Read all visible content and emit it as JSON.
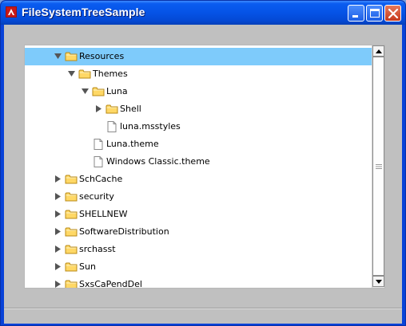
{
  "window": {
    "title": "FileSystemTreeSample"
  },
  "titlebar_buttons": {
    "minimize": "minimize-icon",
    "maximize": "maximize-icon",
    "close": "close-icon"
  },
  "tree": {
    "selected_index": 0,
    "items": [
      {
        "label": "Resources",
        "type": "folder",
        "depth": 0,
        "expander": "expanded"
      },
      {
        "label": "Themes",
        "type": "folder",
        "depth": 1,
        "expander": "expanded"
      },
      {
        "label": "Luna",
        "type": "folder",
        "depth": 2,
        "expander": "expanded"
      },
      {
        "label": "Shell",
        "type": "folder",
        "depth": 3,
        "expander": "collapsed"
      },
      {
        "label": "luna.msstyles",
        "type": "file",
        "depth": 3,
        "expander": "none"
      },
      {
        "label": "Luna.theme",
        "type": "file",
        "depth": 2,
        "expander": "none"
      },
      {
        "label": "Windows Classic.theme",
        "type": "file",
        "depth": 2,
        "expander": "none"
      },
      {
        "label": "SchCache",
        "type": "folder",
        "depth": 0,
        "expander": "collapsed"
      },
      {
        "label": "security",
        "type": "folder",
        "depth": 0,
        "expander": "collapsed"
      },
      {
        "label": "SHELLNEW",
        "type": "folder",
        "depth": 0,
        "expander": "collapsed"
      },
      {
        "label": "SoftwareDistribution",
        "type": "folder",
        "depth": 0,
        "expander": "collapsed"
      },
      {
        "label": "srchasst",
        "type": "folder",
        "depth": 0,
        "expander": "collapsed"
      },
      {
        "label": "Sun",
        "type": "folder",
        "depth": 0,
        "expander": "collapsed"
      },
      {
        "label": "SxsCaPendDel",
        "type": "folder",
        "depth": 0,
        "expander": "collapsed"
      }
    ]
  },
  "colors": {
    "selection": "#7ecbfb",
    "folder_fill": "#ffd866",
    "folder_stroke": "#b88a14"
  }
}
